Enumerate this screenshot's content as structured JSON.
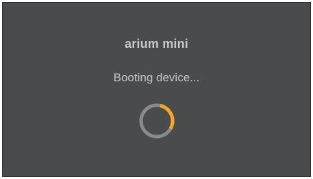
{
  "device": {
    "name": "arium mini",
    "status_text": "Booting device..."
  },
  "spinner": {
    "icon": "loading-spinner-icon",
    "progress_fraction": 0.3,
    "track_color": "#8a8a8a",
    "accent_color": "#f5a623"
  },
  "colors": {
    "background": "#4a4b4c",
    "text": "#c7c7c7"
  }
}
